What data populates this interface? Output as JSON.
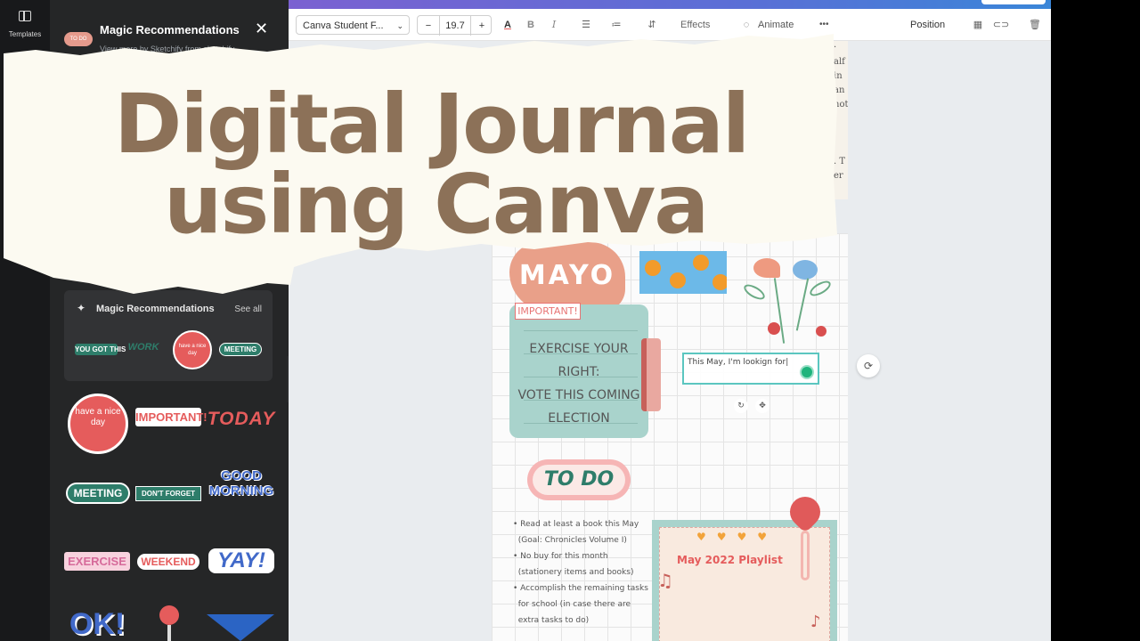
{
  "sidebar_rail": {
    "templates_label": "Templates"
  },
  "panel": {
    "title": "Magic Recommendations",
    "subtitle": "View more by Sketchify from sketchify",
    "close": "✕",
    "card_title": "Magic Recommendations",
    "see_all": "See all",
    "card_stickers": [
      "YOU GOT THIS",
      "WORK",
      "have a nice day",
      "MEETING"
    ],
    "stickers": [
      "have a nice day",
      "IMPORTANT!",
      "TODAY",
      "MEETING",
      "DON'T FORGET",
      "GOOD MORNING",
      "EXERCISE",
      "WEEKEND",
      "YAY!",
      "OK!"
    ]
  },
  "toolbar": {
    "font": "Canva Student F...",
    "size_minus": "−",
    "size": "19.7",
    "size_plus": "+",
    "text_color_icon": "A",
    "bold": "B",
    "italic": "I",
    "effects": "Effects",
    "animate": "Animate",
    "more": "•••",
    "position": "Position"
  },
  "journal": {
    "month_badge": "MAYO",
    "important_label": "IMPORTANT!",
    "note_lines": [
      "EXERCISE YOUR",
      "RIGHT:",
      "VOTE THIS COMING",
      "ELECTION"
    ],
    "text_box_value": "This May, I'm lookign for|",
    "todo_label": "TO DO",
    "todo_items": [
      [
        "Read at least a book this May",
        "(Goal: Chronicles Volume I)"
      ],
      [
        "No buy for this month",
        "(stationery items and books)"
      ],
      [
        "Accomplish the remaining tasks",
        "for school (in case there are",
        "extra tasks to do)"
      ]
    ],
    "playlist_title": "May 2022 Playlist"
  },
  "overlay": {
    "line1": "Digital Journal",
    "line2": "using Canva"
  }
}
